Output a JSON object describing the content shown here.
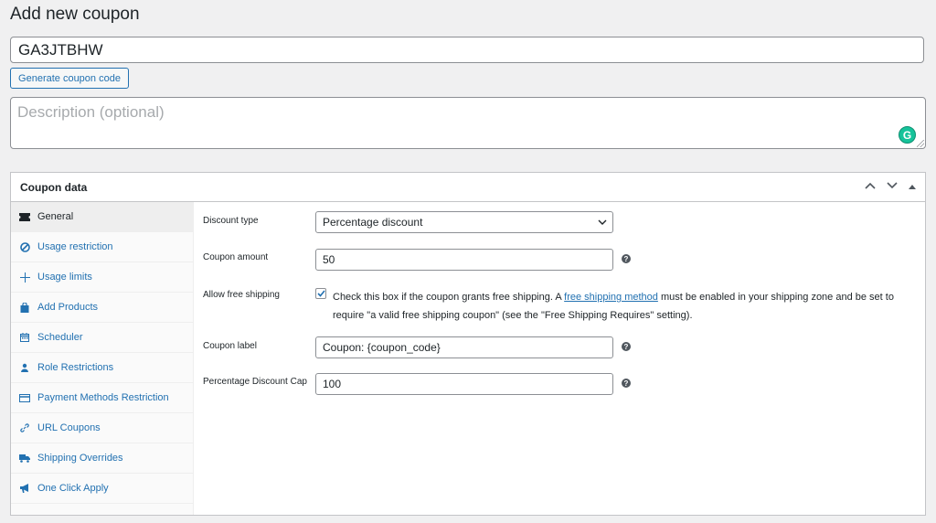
{
  "page": {
    "title": "Add new coupon"
  },
  "coupon": {
    "code": "GA3JTBHW",
    "generate_label": "Generate coupon code",
    "description_placeholder": "Description (optional)"
  },
  "panel": {
    "title": "Coupon data",
    "tabs": [
      {
        "label": "General",
        "icon": "ticket-icon"
      },
      {
        "label": "Usage restriction",
        "icon": "block-icon"
      },
      {
        "label": "Usage limits",
        "icon": "plus-icon"
      },
      {
        "label": "Add Products",
        "icon": "bag-icon"
      },
      {
        "label": "Scheduler",
        "icon": "calendar-icon"
      },
      {
        "label": "Role Restrictions",
        "icon": "user-icon"
      },
      {
        "label": "Payment Methods Restriction",
        "icon": "card-icon"
      },
      {
        "label": "URL Coupons",
        "icon": "link-icon"
      },
      {
        "label": "Shipping Overrides",
        "icon": "truck-icon"
      },
      {
        "label": "One Click Apply",
        "icon": "megaphone-icon"
      }
    ]
  },
  "general": {
    "discount_type_label": "Discount type",
    "discount_type_value": "Percentage discount",
    "coupon_amount_label": "Coupon amount",
    "coupon_amount_value": "50",
    "free_shipping_label": "Allow free shipping",
    "free_shipping_checked": true,
    "free_shipping_text_before": "Check this box if the coupon grants free shipping. A ",
    "free_shipping_link": "free shipping method",
    "free_shipping_text_after": " must be enabled in your shipping zone and be set to require \"a valid free shipping coupon\" (see the \"Free Shipping Requires\" setting).",
    "coupon_label_label": "Coupon label",
    "coupon_label_value": "Coupon: {coupon_code}",
    "discount_cap_label": "Percentage Discount Cap",
    "discount_cap_value": "100"
  }
}
